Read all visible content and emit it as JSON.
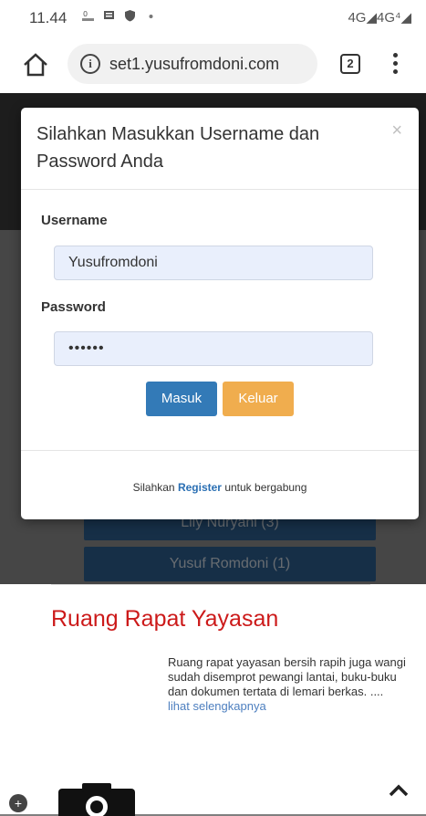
{
  "status_bar": {
    "time": "11.44",
    "network": "4G◢4G⁴◢"
  },
  "browser": {
    "url": "set1.yusufromdoni.com",
    "tab_count": "2"
  },
  "background_page": {
    "category_buttons": [
      "Lily Nuryani (3)",
      "Yusuf Romdoni (1)"
    ],
    "room_title": "Ruang Rapat Yayasan",
    "room_description": "Ruang rapat yayasan bersih rapih juga wangi sudah disemprot pewangi lantai, buku-buku dan dokumen tertata di lemari berkas. ....",
    "room_link": "lihat selengkapnya"
  },
  "modal": {
    "title": "Silahkan Masukkan Username dan Password Anda",
    "close_symbol": "×",
    "username_label": "Username",
    "username_value": "Yusufromdoni",
    "password_label": "Password",
    "password_value": "••••••",
    "submit_label": "Masuk",
    "exit_label": "Keluar",
    "footer_prefix": "Silahkan",
    "footer_link": "Register",
    "footer_suffix": "untuk bergabung"
  },
  "colors": {
    "primary_button": "#337ab7",
    "warning_button": "#f0ad4e",
    "room_title": "#cc1a1a",
    "category_button": "#2c5e8e"
  }
}
